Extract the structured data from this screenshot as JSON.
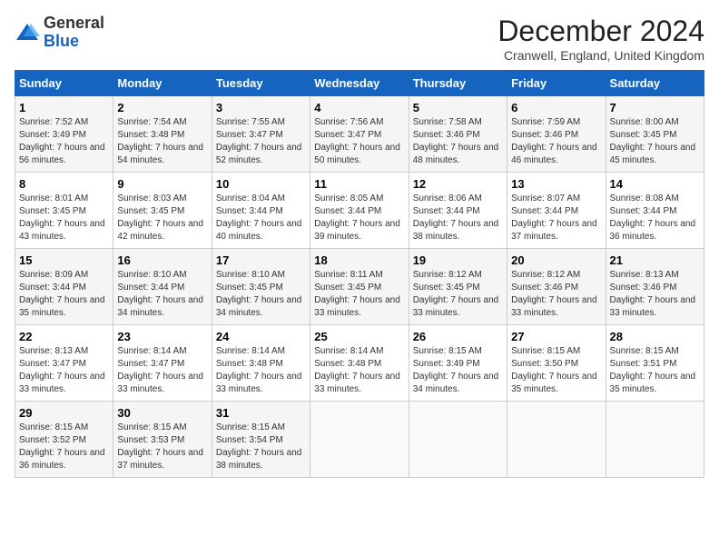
{
  "header": {
    "logo_general": "General",
    "logo_blue": "Blue",
    "title": "December 2024",
    "subtitle": "Cranwell, England, United Kingdom"
  },
  "weekdays": [
    "Sunday",
    "Monday",
    "Tuesday",
    "Wednesday",
    "Thursday",
    "Friday",
    "Saturday"
  ],
  "weeks": [
    [
      {
        "day": "1",
        "sunrise": "Sunrise: 7:52 AM",
        "sunset": "Sunset: 3:49 PM",
        "daylight": "Daylight: 7 hours and 56 minutes."
      },
      {
        "day": "2",
        "sunrise": "Sunrise: 7:54 AM",
        "sunset": "Sunset: 3:48 PM",
        "daylight": "Daylight: 7 hours and 54 minutes."
      },
      {
        "day": "3",
        "sunrise": "Sunrise: 7:55 AM",
        "sunset": "Sunset: 3:47 PM",
        "daylight": "Daylight: 7 hours and 52 minutes."
      },
      {
        "day": "4",
        "sunrise": "Sunrise: 7:56 AM",
        "sunset": "Sunset: 3:47 PM",
        "daylight": "Daylight: 7 hours and 50 minutes."
      },
      {
        "day": "5",
        "sunrise": "Sunrise: 7:58 AM",
        "sunset": "Sunset: 3:46 PM",
        "daylight": "Daylight: 7 hours and 48 minutes."
      },
      {
        "day": "6",
        "sunrise": "Sunrise: 7:59 AM",
        "sunset": "Sunset: 3:46 PM",
        "daylight": "Daylight: 7 hours and 46 minutes."
      },
      {
        "day": "7",
        "sunrise": "Sunrise: 8:00 AM",
        "sunset": "Sunset: 3:45 PM",
        "daylight": "Daylight: 7 hours and 45 minutes."
      }
    ],
    [
      {
        "day": "8",
        "sunrise": "Sunrise: 8:01 AM",
        "sunset": "Sunset: 3:45 PM",
        "daylight": "Daylight: 7 hours and 43 minutes."
      },
      {
        "day": "9",
        "sunrise": "Sunrise: 8:03 AM",
        "sunset": "Sunset: 3:45 PM",
        "daylight": "Daylight: 7 hours and 42 minutes."
      },
      {
        "day": "10",
        "sunrise": "Sunrise: 8:04 AM",
        "sunset": "Sunset: 3:44 PM",
        "daylight": "Daylight: 7 hours and 40 minutes."
      },
      {
        "day": "11",
        "sunrise": "Sunrise: 8:05 AM",
        "sunset": "Sunset: 3:44 PM",
        "daylight": "Daylight: 7 hours and 39 minutes."
      },
      {
        "day": "12",
        "sunrise": "Sunrise: 8:06 AM",
        "sunset": "Sunset: 3:44 PM",
        "daylight": "Daylight: 7 hours and 38 minutes."
      },
      {
        "day": "13",
        "sunrise": "Sunrise: 8:07 AM",
        "sunset": "Sunset: 3:44 PM",
        "daylight": "Daylight: 7 hours and 37 minutes."
      },
      {
        "day": "14",
        "sunrise": "Sunrise: 8:08 AM",
        "sunset": "Sunset: 3:44 PM",
        "daylight": "Daylight: 7 hours and 36 minutes."
      }
    ],
    [
      {
        "day": "15",
        "sunrise": "Sunrise: 8:09 AM",
        "sunset": "Sunset: 3:44 PM",
        "daylight": "Daylight: 7 hours and 35 minutes."
      },
      {
        "day": "16",
        "sunrise": "Sunrise: 8:10 AM",
        "sunset": "Sunset: 3:44 PM",
        "daylight": "Daylight: 7 hours and 34 minutes."
      },
      {
        "day": "17",
        "sunrise": "Sunrise: 8:10 AM",
        "sunset": "Sunset: 3:45 PM",
        "daylight": "Daylight: 7 hours and 34 minutes."
      },
      {
        "day": "18",
        "sunrise": "Sunrise: 8:11 AM",
        "sunset": "Sunset: 3:45 PM",
        "daylight": "Daylight: 7 hours and 33 minutes."
      },
      {
        "day": "19",
        "sunrise": "Sunrise: 8:12 AM",
        "sunset": "Sunset: 3:45 PM",
        "daylight": "Daylight: 7 hours and 33 minutes."
      },
      {
        "day": "20",
        "sunrise": "Sunrise: 8:12 AM",
        "sunset": "Sunset: 3:46 PM",
        "daylight": "Daylight: 7 hours and 33 minutes."
      },
      {
        "day": "21",
        "sunrise": "Sunrise: 8:13 AM",
        "sunset": "Sunset: 3:46 PM",
        "daylight": "Daylight: 7 hours and 33 minutes."
      }
    ],
    [
      {
        "day": "22",
        "sunrise": "Sunrise: 8:13 AM",
        "sunset": "Sunset: 3:47 PM",
        "daylight": "Daylight: 7 hours and 33 minutes."
      },
      {
        "day": "23",
        "sunrise": "Sunrise: 8:14 AM",
        "sunset": "Sunset: 3:47 PM",
        "daylight": "Daylight: 7 hours and 33 minutes."
      },
      {
        "day": "24",
        "sunrise": "Sunrise: 8:14 AM",
        "sunset": "Sunset: 3:48 PM",
        "daylight": "Daylight: 7 hours and 33 minutes."
      },
      {
        "day": "25",
        "sunrise": "Sunrise: 8:14 AM",
        "sunset": "Sunset: 3:48 PM",
        "daylight": "Daylight: 7 hours and 33 minutes."
      },
      {
        "day": "26",
        "sunrise": "Sunrise: 8:15 AM",
        "sunset": "Sunset: 3:49 PM",
        "daylight": "Daylight: 7 hours and 34 minutes."
      },
      {
        "day": "27",
        "sunrise": "Sunrise: 8:15 AM",
        "sunset": "Sunset: 3:50 PM",
        "daylight": "Daylight: 7 hours and 35 minutes."
      },
      {
        "day": "28",
        "sunrise": "Sunrise: 8:15 AM",
        "sunset": "Sunset: 3:51 PM",
        "daylight": "Daylight: 7 hours and 35 minutes."
      }
    ],
    [
      {
        "day": "29",
        "sunrise": "Sunrise: 8:15 AM",
        "sunset": "Sunset: 3:52 PM",
        "daylight": "Daylight: 7 hours and 36 minutes."
      },
      {
        "day": "30",
        "sunrise": "Sunrise: 8:15 AM",
        "sunset": "Sunset: 3:53 PM",
        "daylight": "Daylight: 7 hours and 37 minutes."
      },
      {
        "day": "31",
        "sunrise": "Sunrise: 8:15 AM",
        "sunset": "Sunset: 3:54 PM",
        "daylight": "Daylight: 7 hours and 38 minutes."
      },
      null,
      null,
      null,
      null
    ]
  ]
}
